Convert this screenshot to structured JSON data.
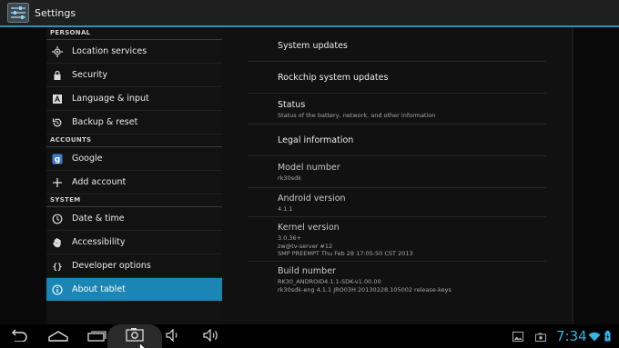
{
  "app": {
    "title": "Settings",
    "icon": "settings-sliders-icon"
  },
  "sidebar": {
    "sections": [
      {
        "header": "Personal",
        "items": [
          {
            "label": "Location services",
            "icon": "location-icon"
          },
          {
            "label": "Security",
            "icon": "lock-icon"
          },
          {
            "label": "Language & input",
            "icon": "keyboard-icon"
          },
          {
            "label": "Backup & reset",
            "icon": "backup-icon"
          }
        ]
      },
      {
        "header": "Accounts",
        "items": [
          {
            "label": "Google",
            "icon": "google-icon"
          },
          {
            "label": "Add account",
            "icon": "plus-icon"
          }
        ]
      },
      {
        "header": "System",
        "items": [
          {
            "label": "Date & time",
            "icon": "clock-icon"
          },
          {
            "label": "Accessibility",
            "icon": "hand-icon"
          },
          {
            "label": "Developer options",
            "icon": "braces-icon"
          },
          {
            "label": "About tablet",
            "icon": "info-icon",
            "selected": true
          }
        ]
      }
    ]
  },
  "about": {
    "system_updates": "System updates",
    "rockchip_updates": "Rockchip system updates",
    "status": {
      "title": "Status",
      "summary": "Status of the battery, network, and other information"
    },
    "legal": "Legal information",
    "model": {
      "title": "Model number",
      "value": "rk30sdk"
    },
    "android": {
      "title": "Android version",
      "value": "4.1.1"
    },
    "kernel": {
      "title": "Kernel version",
      "line1": "3.0.36+",
      "line2": "zw@tv-server #12",
      "line3": "SMP PREEMPT Thu Feb 28 17:05:50 CST 2013"
    },
    "build": {
      "title": "Build number",
      "line1": "RK30_ANDROID4.1.1-SDK-v1.00.00",
      "line2": "rk30sdk-eng 4.1.1 JRO03H 20130228.105002 release-keys"
    }
  },
  "navbar": {
    "clock": "7:34",
    "accent": "#34b5e5"
  },
  "colors": {
    "selected": "#1b86b3",
    "accent": "#2e90b8"
  }
}
